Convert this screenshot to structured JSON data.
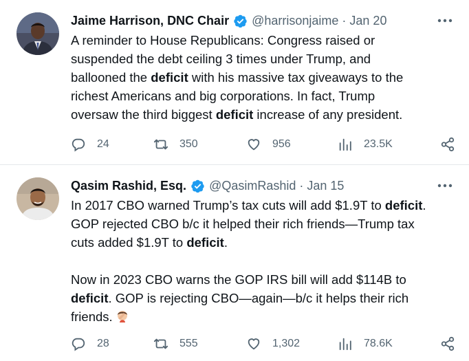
{
  "tweets": [
    {
      "display_name": "Jaime Harrison, DNC Chair",
      "handle": "@harrisonjaime",
      "separator": "·",
      "time": "Jan 20",
      "lines": [
        [
          {
            "t": "A reminder to House Republicans: Congress raised or"
          }
        ],
        [
          {
            "t": "suspended the debt ceiling 3 times under Trump, and"
          }
        ],
        [
          {
            "t": "ballooned the "
          },
          {
            "t": "deficit",
            "b": true
          },
          {
            "t": " with his massive tax giveaways to the"
          }
        ],
        [
          {
            "t": "richest Americans and big corporations. In fact, Trump"
          }
        ],
        [
          {
            "t": "oversaw the third biggest "
          },
          {
            "t": "deficit",
            "b": true
          },
          {
            "t": " increase of any president."
          }
        ]
      ],
      "replies": "24",
      "retweets": "350",
      "likes": "956",
      "views": "23.5K"
    },
    {
      "display_name": "Qasim Rashid, Esq.",
      "handle": "@QasimRashid",
      "separator": "·",
      "time": "Jan 15",
      "lines": [
        [
          {
            "t": "In 2017 CBO warned Trump’s tax cuts will add $1.9T to "
          },
          {
            "t": "deficit",
            "b": true
          },
          {
            "t": "."
          }
        ],
        [
          {
            "t": "GOP rejected CBO b/c it helped their rich friends—Trump tax"
          }
        ],
        [
          {
            "t": "cuts added $1.9T to "
          },
          {
            "t": "deficit",
            "b": true
          },
          {
            "t": "."
          }
        ],
        [],
        [
          {
            "t": "Now in 2023 CBO warns the GOP IRS bill will add $114B to"
          }
        ],
        [
          {
            "t": "deficit",
            "b": true
          },
          {
            "t": ". GOP is rejecting CBO—again—b/c it helps their rich"
          }
        ],
        [
          {
            "t": "friends."
          }
        ]
      ],
      "trailing_emoji": "person-facepalming-emoji",
      "replies": "28",
      "retweets": "555",
      "likes": "1,302",
      "views": "78.6K"
    }
  ],
  "icons": {
    "verified": "verified-badge-icon",
    "more": "more-dots-icon",
    "reply": "reply-icon",
    "retweet": "retweet-icon",
    "like": "heart-icon",
    "views": "views-chart-icon",
    "share": "share-icon"
  },
  "colors": {
    "verified_blue": "#1d9bf0",
    "text": "#0f1419",
    "secondary": "#536471",
    "divider": "#e4e8eb"
  }
}
